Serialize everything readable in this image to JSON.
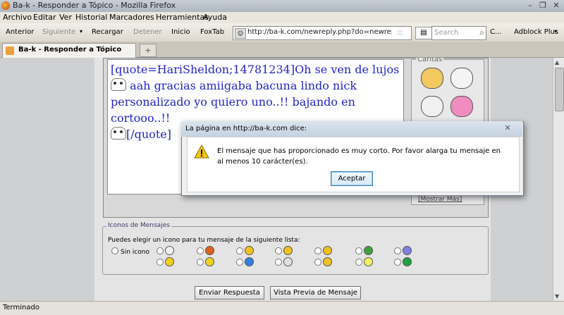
{
  "window": {
    "title": "Ba-k - Responder a Tópico - Mozilla Firefox",
    "controls": [
      "–",
      "❐",
      "✕"
    ]
  },
  "menu": [
    "Archivo",
    "Editar",
    "Ver",
    "Historial",
    "Marcadores",
    "Herramientas",
    "Ayuda"
  ],
  "nav": {
    "back": "Anterior",
    "forward": "Siguiente",
    "reload": "Recargar",
    "stop": "Detener",
    "home": "Inicio",
    "foxtab": "FoxTab",
    "url": "http://ba-k.com/newreply.php?do=newreply",
    "search_placeholder": "Search",
    "more": "C...",
    "adblock": "Adblock Plus"
  },
  "tab": {
    "label": "Ba-k - Responder a Tópico",
    "new_tab": "+"
  },
  "editor": {
    "line1": "[quote=HariSheldon;14781234]Oh se ven de lujos",
    "line2": "aah gracias amiigaba bacuna lindo nick",
    "line3": "personalizado yo quiero uno..!! bajando en cortooo..!!",
    "line4": "[/quote]"
  },
  "caritas": {
    "label": "Caritas",
    "more_link": "[Mostrar Más]"
  },
  "icons": {
    "legend": "Iconos de Mensajes",
    "description": "Puedes elegir un icono para tu mensaje de la siguiente lista:",
    "no_icon": "Sin icono",
    "row1": [
      "page",
      "question",
      "tongue",
      "wink",
      "laugh",
      "grin",
      "sad",
      "angry"
    ],
    "row2": [
      "smile",
      "cool",
      "info",
      "thumb-down",
      "warning",
      "lightbulb",
      "arrow",
      "thumbs-up"
    ],
    "row1_colors": [
      "#f0f0f0",
      "#e06020",
      "#f0c020",
      "#f0c020",
      "#f0c020",
      "#40a040",
      "#8080e0",
      "#e04040"
    ],
    "row2_colors": [
      "#f0d020",
      "#f0d020",
      "#3080e0",
      "#e0e0e0",
      "#f0c020",
      "#f0f060",
      "#20a040",
      "#f0a020"
    ]
  },
  "buttons": {
    "submit": "Enviar Respuesta",
    "preview": "Vista Previa de Mensaje"
  },
  "status": "Terminado",
  "dialog": {
    "title": "La página en http://ba-k.com dice:",
    "message": "El mensaje que has proporcionado es muy corto. Por favor alarga tu mensaje en al menos 10 carácter(es).",
    "ok": "Aceptar"
  }
}
